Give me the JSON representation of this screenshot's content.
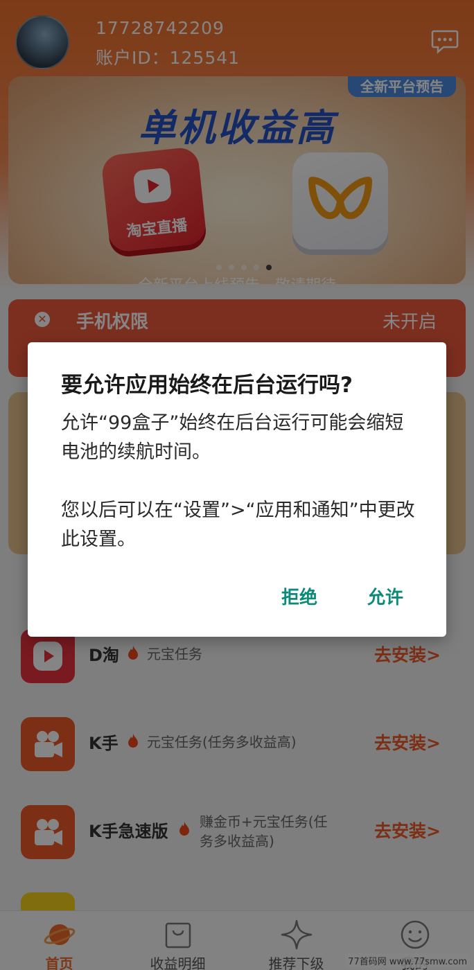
{
  "header": {
    "phone": "17728742209",
    "account_id": "账户ID：125541"
  },
  "banner": {
    "tag": "全新平台预告",
    "title": "单机收益高",
    "taobao_logo_text": "淘宝直播",
    "caption": "全新平台上线预告，敬请期待",
    "slides_total": 5,
    "active_slide": 5
  },
  "permission": {
    "title": "手机权限",
    "status": "未开启"
  },
  "apps": [
    {
      "name": "D淘",
      "desc": "元宝任务",
      "action": "去安装>",
      "icon_color": "#e8333f"
    },
    {
      "name": "K手",
      "desc": "元宝任务(任务多收益高)",
      "action": "去安装>",
      "icon_color": "#f05a2a"
    },
    {
      "name": "K手急速版",
      "desc_line1": "赚金币+元宝任务(任",
      "desc_line2": "务多收益高)",
      "action": "去安装>",
      "icon_color": "#f05a2a"
    }
  ],
  "tabs": [
    {
      "label": "首页",
      "icon": "planet-icon",
      "active": true
    },
    {
      "label": "收益明细",
      "icon": "bag-icon",
      "active": false
    },
    {
      "label": "推荐下级",
      "icon": "star-icon",
      "active": false
    },
    {
      "label": "我的",
      "icon": "smiley-icon",
      "active": false
    }
  ],
  "watermark": "77首码网 www.77smw.com",
  "dialog": {
    "title": "要允许应用始终在后台运行吗?",
    "body_1": "允许“99盒子”始终在后台运行可能会缩短电池的续航时间。",
    "body_2": "您以后可以在“设置”>“应用和通知”中更改此设置。",
    "deny": "拒绝",
    "allow": "允许"
  },
  "colors": {
    "brand_orange": "#f0702a",
    "permission_red": "#f05a3c",
    "dialog_button": "#0d8a7a"
  }
}
